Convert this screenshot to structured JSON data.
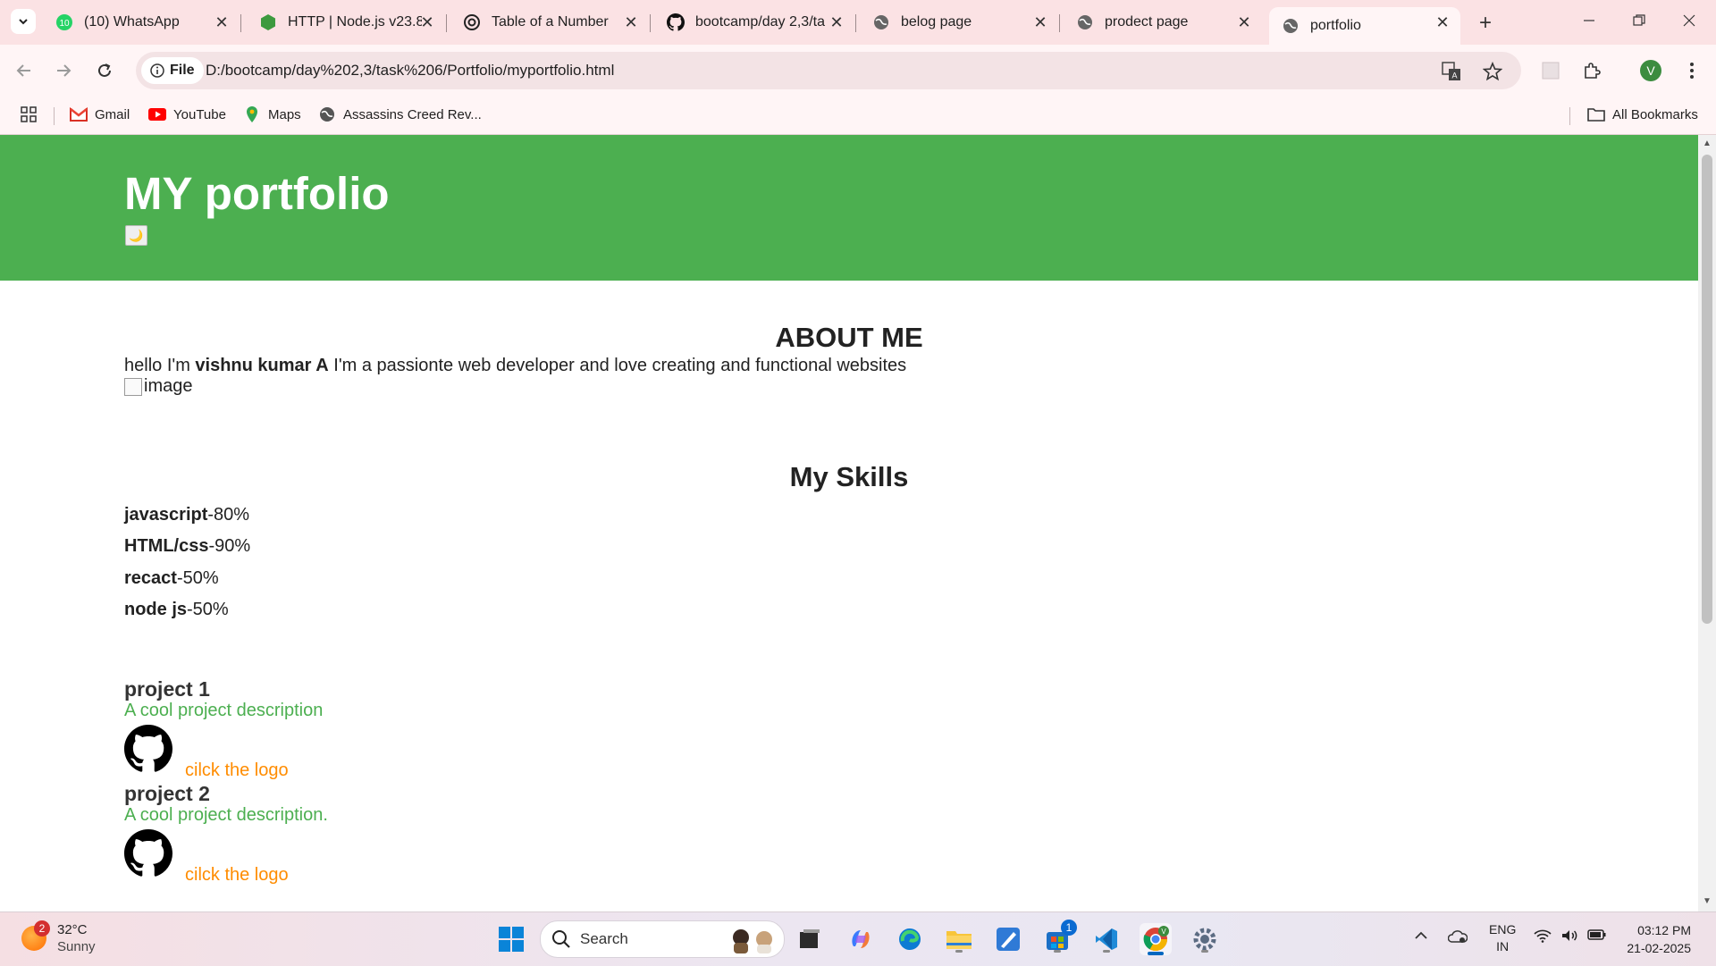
{
  "browser": {
    "tabs": [
      {
        "title": "(10) WhatsApp",
        "icon": "whatsapp-icon"
      },
      {
        "title": "HTTP | Node.js v23.8",
        "icon": "nodejs-icon"
      },
      {
        "title": "Table of a Number",
        "icon": "openai-icon"
      },
      {
        "title": "bootcamp/day 2,3/ta",
        "icon": "github-icon"
      },
      {
        "title": "belog page",
        "icon": "globe-icon"
      },
      {
        "title": "prodect page",
        "icon": "globe-icon"
      },
      {
        "title": "portfolio",
        "icon": "globe-icon"
      }
    ],
    "active_tab": "portfolio",
    "chip_label": "File",
    "url": "D:/bootcamp/day%202,3/task%206/Portfolio/myportfolio.html",
    "avatar_letter": "V",
    "bookmarks": [
      "Gmail",
      "YouTube",
      "Maps",
      "Assassins Creed Rev..."
    ],
    "all_bookmarks": "All Bookmarks"
  },
  "page": {
    "site_title": "MY portfolio",
    "theme_toggle_glyph": "🌙",
    "about": {
      "heading": "ABOUT ME",
      "intro_prefix": "hello I'm ",
      "name": "vishnu kumar A",
      "intro_suffix": " I'm a passionte web developer and love creating and functional websites",
      "image_alt": "image"
    },
    "skills": {
      "heading": "My Skills",
      "items": [
        {
          "name": "javascript",
          "value": "-80%"
        },
        {
          "name": "HTML/css",
          "value": "-90%"
        },
        {
          "name": "recact",
          "value": "-50%"
        },
        {
          "name": "node js",
          "value": "-50%"
        }
      ]
    },
    "projects": [
      {
        "title": "project 1",
        "description": "A cool project description",
        "link": "cilck the logo"
      },
      {
        "title": "project 2",
        "description": "A cool project description.",
        "link": "cilck the logo"
      }
    ],
    "colors": {
      "header": "#4caf50",
      "description": "#4caf50",
      "link": "#ff8c00"
    }
  },
  "taskbar": {
    "weather_temp": "32°C",
    "weather_cond": "Sunny",
    "weather_badge": "2",
    "search_label": "Search",
    "store_badge": "1",
    "lang_top": "ENG",
    "lang_bottom": "IN",
    "time": "03:12 PM",
    "date": "21-02-2025"
  }
}
